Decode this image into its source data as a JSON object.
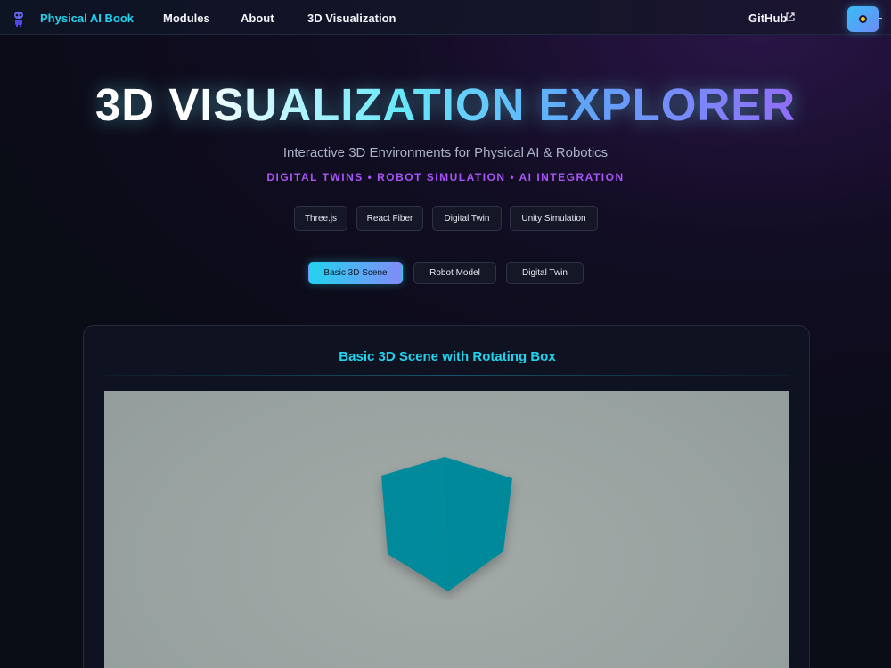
{
  "nav": {
    "brand": "Physical AI Book",
    "links": [
      {
        "label": "Modules"
      },
      {
        "label": "About"
      },
      {
        "label": "3D Visualization"
      }
    ],
    "github_label": "GitHub",
    "icons": {
      "brand": "robot-icon",
      "external": "external-link-icon",
      "theme": "sun-icon"
    }
  },
  "hero": {
    "title": "3D VISUALIZATION EXPLORER",
    "subtitle": "Interactive 3D Environments for Physical AI & Robotics",
    "tagline": "DIGITAL TWINS • ROBOT SIMULATION • AI INTEGRATION",
    "badges": [
      "Three.js",
      "React Fiber",
      "Digital Twin",
      "Unity Simulation"
    ]
  },
  "scene_tabs": {
    "items": [
      "Basic 3D Scene",
      "Robot Model",
      "Digital Twin"
    ],
    "active": "Basic 3D Scene"
  },
  "panel": {
    "title": "Basic 3D Scene with Rotating Box",
    "cube_color": "#00899a"
  },
  "colors": {
    "accent_cyan": "#22d3ee",
    "accent_purple": "#a855f7",
    "background": "#0b0d17",
    "viewport_bg": "#9aa3a1"
  }
}
